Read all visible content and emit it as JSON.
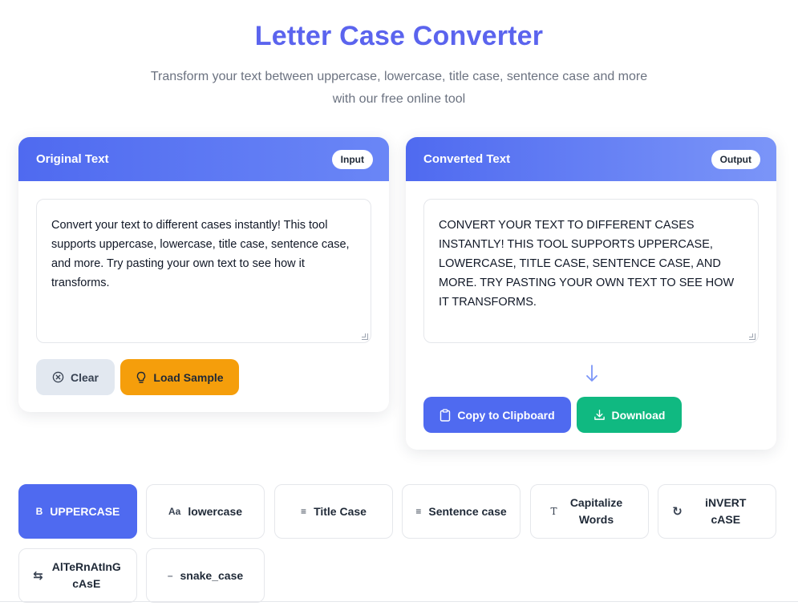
{
  "header": {
    "title": "Letter Case Converter",
    "subtitle": "Transform your text between uppercase, lowercase, title case, sentence case and more with our free online tool"
  },
  "input_card": {
    "title": "Original Text",
    "badge": "Input",
    "text": "Convert your text to different cases instantly! This tool supports uppercase, lowercase, title case, sentence case, and more. Try pasting your own text to see how it transforms.",
    "clear_label": "Clear",
    "sample_label": "Load Sample"
  },
  "output_card": {
    "title": "Converted Text",
    "badge": "Output",
    "text": "CONVERT YOUR TEXT TO DIFFERENT CASES INSTANTLY! THIS TOOL SUPPORTS UPPERCASE, LOWERCASE, TITLE CASE, SENTENCE CASE, AND MORE. TRY PASTING YOUR OWN TEXT TO SEE HOW IT TRANSFORMS.",
    "copy_label": "Copy to Clipboard",
    "download_label": "Download"
  },
  "case_options": [
    {
      "label": "UPPERCASE",
      "icon": "bold-icon",
      "glyph": "B",
      "active": true
    },
    {
      "label": "lowercase",
      "icon": "font-size-icon",
      "glyph": "Aa",
      "active": false
    },
    {
      "label": "Title Case",
      "icon": "align-center-icon",
      "glyph": "≡",
      "active": false
    },
    {
      "label": "Sentence case",
      "icon": "align-left-icon",
      "glyph": "≡",
      "active": false
    },
    {
      "label": "Capitalize Words",
      "icon": "text-icon",
      "glyph": "T",
      "active": false
    },
    {
      "label": "iNVERT cASE",
      "icon": "refresh-icon",
      "glyph": "↻",
      "active": false
    },
    {
      "label": "AlTeRnAtInG cAsE",
      "icon": "exchange-icon",
      "glyph": "⇆",
      "active": false
    },
    {
      "label": "snake_case",
      "icon": "minus-icon",
      "glyph": "–",
      "active": false
    }
  ],
  "colors": {
    "accent": "#4f6af0",
    "title": "#5b64ee",
    "sample": "#f59e0b",
    "download": "#10b981",
    "clear": "#e2e8f0"
  }
}
